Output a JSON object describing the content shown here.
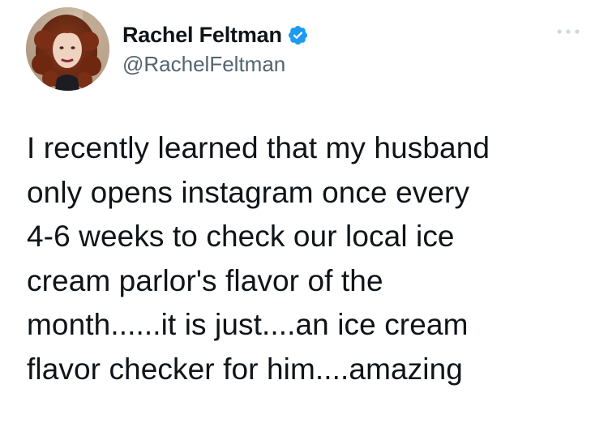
{
  "tweet": {
    "author": {
      "display_name": "Rachel Feltman",
      "handle": "@RachelFeltman",
      "verified": true,
      "avatar_icon": "profile-photo"
    },
    "more_icon": "more-options-icon",
    "text_lines": [
      "I recently learned that my husband",
      "only opens instagram once every",
      "4-6 weeks to check our local ice",
      "cream parlor's flavor of the",
      "month......it is just....an ice cream",
      "flavor checker for him....amazing"
    ]
  },
  "colors": {
    "text": "#0f1419",
    "secondary": "#536471",
    "verified_blue": "#1d9bf0",
    "background": "#ffffff"
  }
}
